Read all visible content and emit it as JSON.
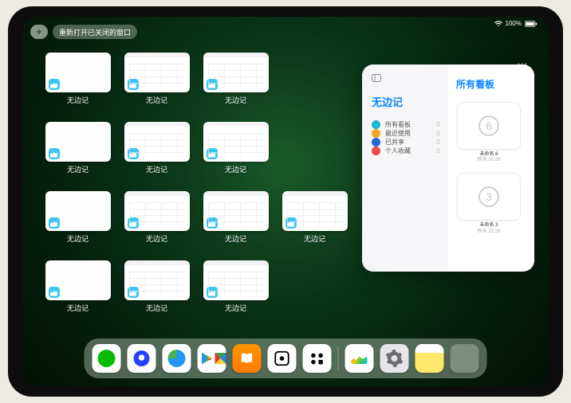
{
  "status": {
    "battery": "100%"
  },
  "controls": {
    "plus_label": "+",
    "reopen_label": "重新打开已关闭的窗口"
  },
  "app_grid": {
    "app_name": "无边记",
    "windows": [
      {
        "style": "blank"
      },
      {
        "style": "content"
      },
      {
        "style": "content"
      },
      {
        "style": "blank"
      },
      {
        "style": "content"
      },
      {
        "style": "content"
      },
      {
        "style": "blank"
      },
      {
        "style": "content"
      },
      {
        "style": "content"
      },
      {
        "style": "content"
      },
      {
        "style": "blank"
      },
      {
        "style": "content"
      },
      {
        "style": "content"
      }
    ]
  },
  "popover": {
    "ellipsis": "•••",
    "left_title": "无边记",
    "right_title": "所有看板",
    "menu": [
      {
        "icon_color": "c1",
        "label": "所有看板",
        "count": "0"
      },
      {
        "icon_color": "c2",
        "label": "最近使用",
        "count": "0"
      },
      {
        "icon_color": "c3",
        "label": "已共享",
        "count": "0"
      },
      {
        "icon_color": "c4",
        "label": "个人收藏",
        "count": "0"
      }
    ],
    "boards": [
      {
        "title": "未命名 6",
        "subtitle": "昨天 15:26",
        "glyph": "6"
      },
      {
        "title": "未命名 3",
        "subtitle": "昨天 15:25",
        "glyph": "3"
      }
    ]
  },
  "dock": {
    "icons": [
      {
        "name": "wechat"
      },
      {
        "name": "qqbrowser"
      },
      {
        "name": "quark"
      },
      {
        "name": "playstore"
      },
      {
        "name": "books"
      },
      {
        "name": "dice"
      },
      {
        "name": "shapes"
      },
      {
        "name": "freeform"
      },
      {
        "name": "settings"
      },
      {
        "name": "notes"
      },
      {
        "name": "app-library"
      }
    ]
  }
}
